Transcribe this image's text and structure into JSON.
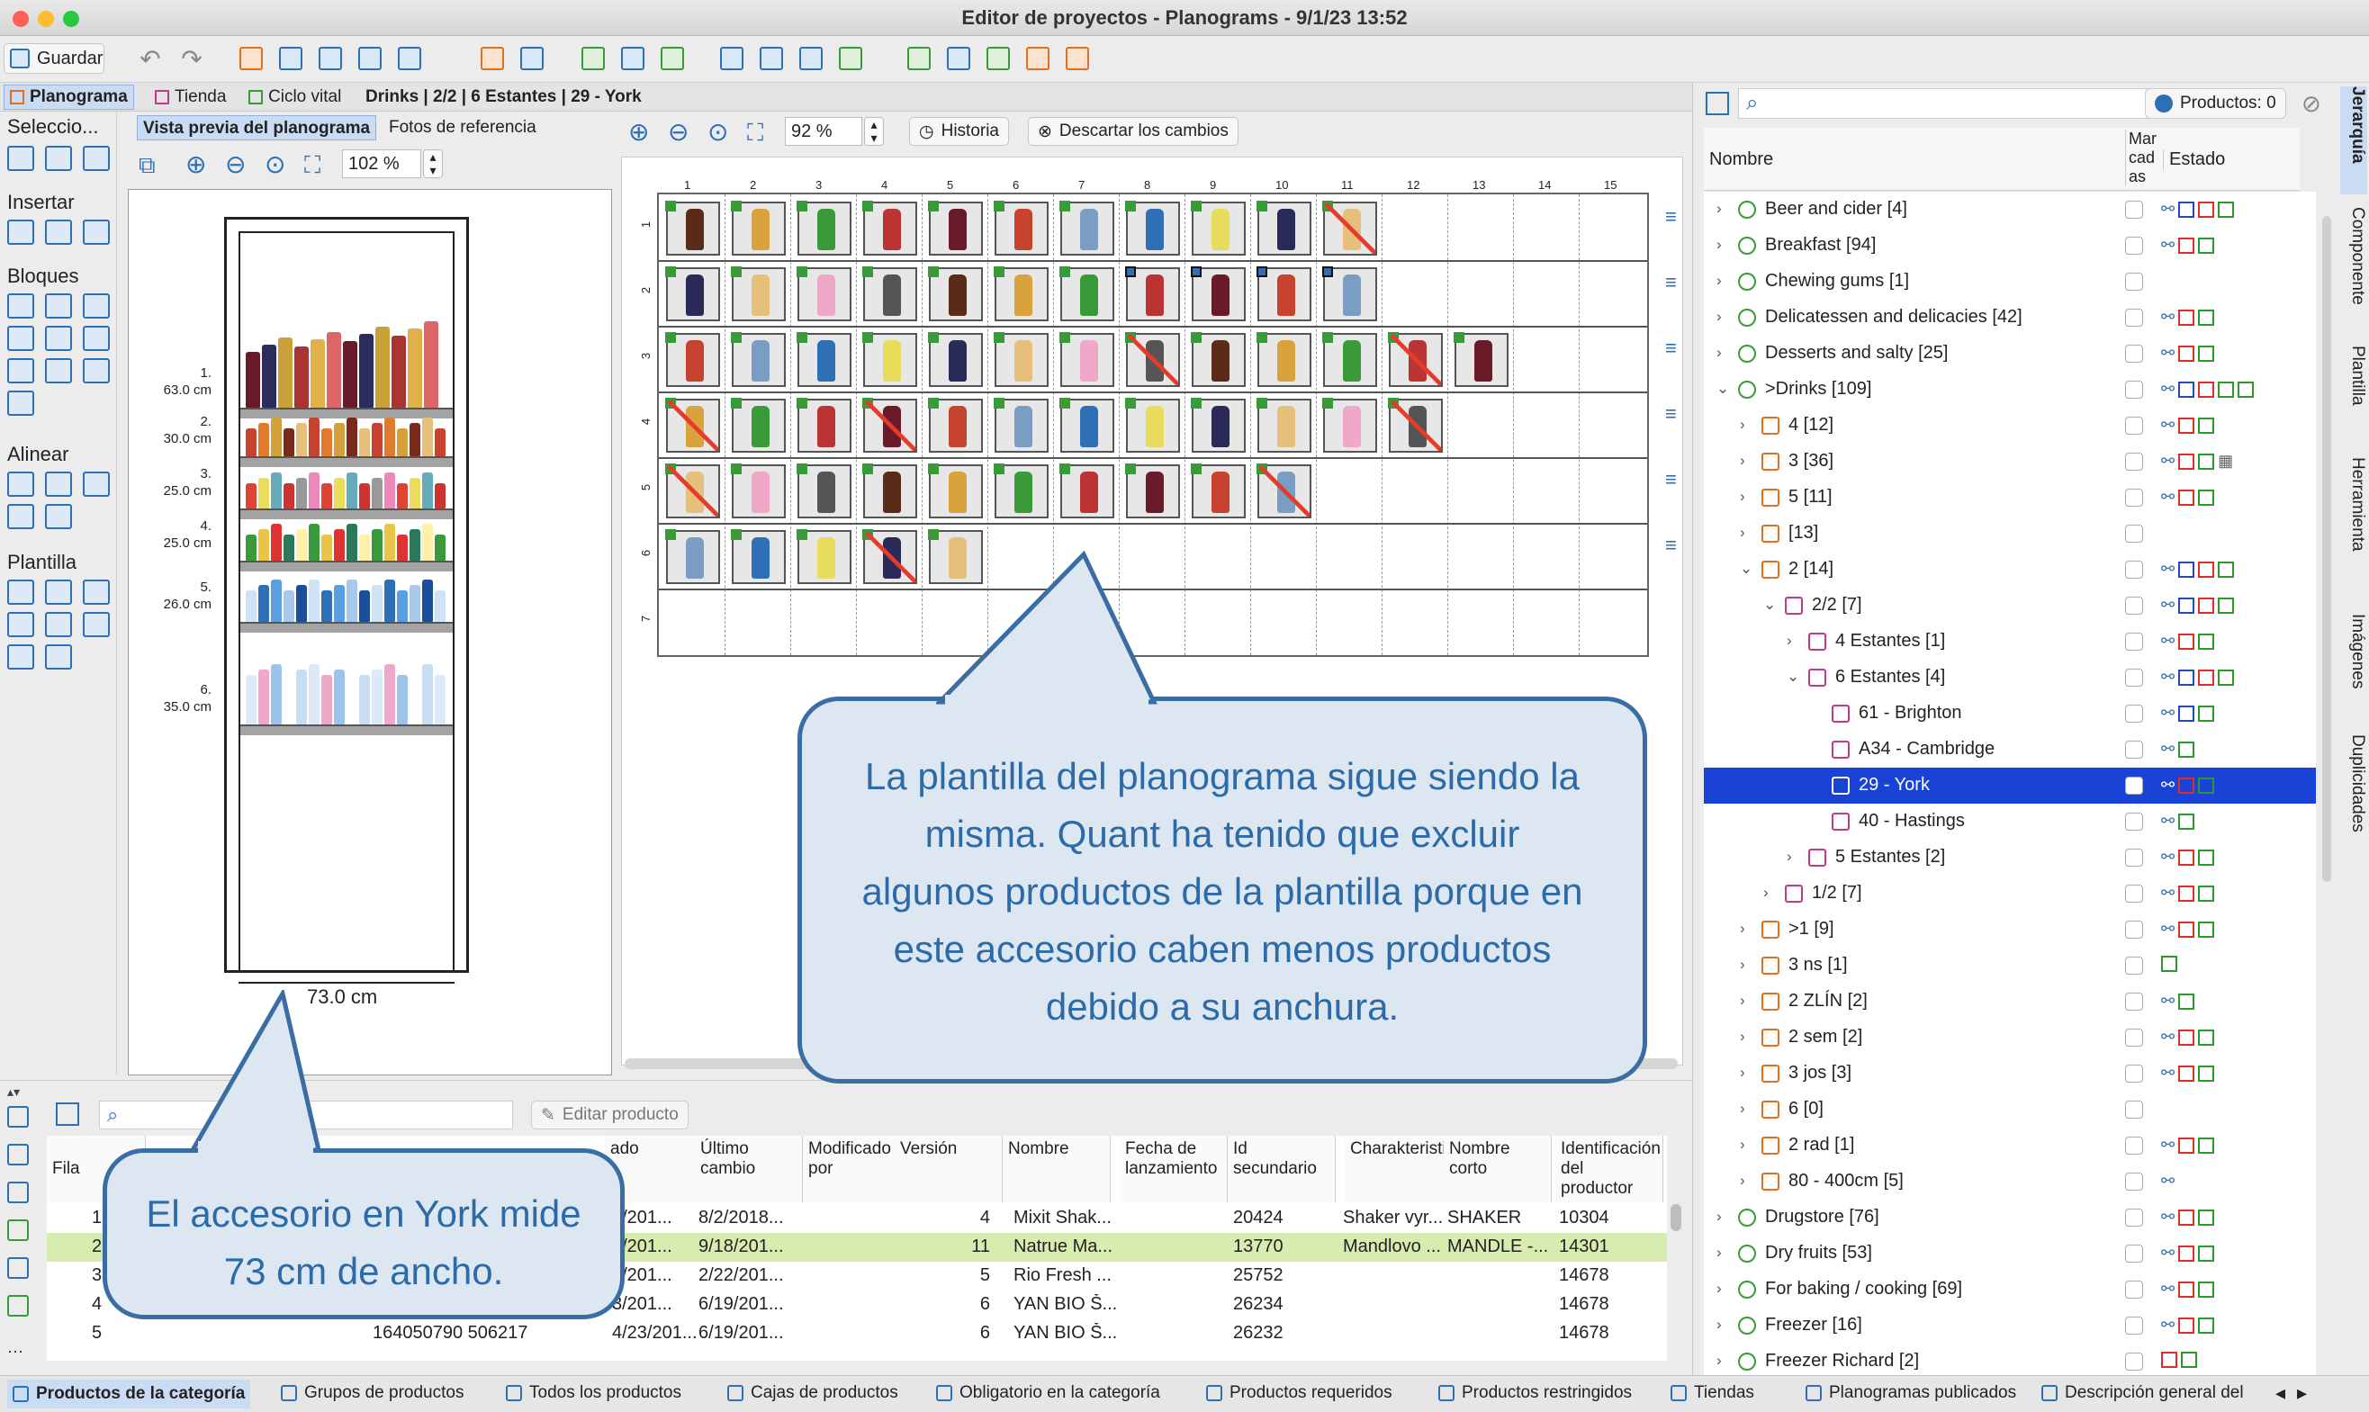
{
  "window": {
    "title": "Editor de proyectos - Planograms - 9/1/23 13:52"
  },
  "toolbar": {
    "save_label": "Guardar"
  },
  "tabs": {
    "planograma": "Planograma",
    "tienda": "Tienda",
    "ciclo": "Ciclo vital",
    "breadcrumb": "Drinks | 2/2 | 6 Estantes | 29 - York"
  },
  "left": {
    "selection": "Seleccio...",
    "insert": "Insertar",
    "blocks": "Bloques",
    "align": "Alinear",
    "template": "Plantilla"
  },
  "preview": {
    "tab_preview": "Vista previa del planograma",
    "tab_photos": "Fotos de referencia",
    "zoom": "102 %",
    "width_label": "73.0 cm",
    "shelves": [
      {
        "n": "1.",
        "h": "63.0 cm"
      },
      {
        "n": "2.",
        "h": "30.0 cm"
      },
      {
        "n": "3.",
        "h": "25.0 cm"
      },
      {
        "n": "4.",
        "h": "25.0 cm"
      },
      {
        "n": "5.",
        "h": "26.0 cm"
      },
      {
        "n": "6.",
        "h": "35.0 cm"
      }
    ]
  },
  "editor": {
    "zoom": "92 %",
    "history": "Historia",
    "discard": "Descartar los cambios",
    "cols": [
      "1",
      "2",
      "3",
      "4",
      "5",
      "6",
      "7",
      "8",
      "9",
      "10",
      "11",
      "12",
      "13",
      "14",
      "15"
    ],
    "rows": [
      "1",
      "2",
      "3",
      "4",
      "5",
      "6",
      "7"
    ]
  },
  "callouts": {
    "main": "La plantilla del planograma sigue siendo la misma. Quant ha tenido que excluir algunos productos de la plantilla porque en este accesorio caben menos productos debido a su anchura.",
    "small": "El accesorio en York mide 73 cm de ancho."
  },
  "products_panel": {
    "edit_button": "Editar producto",
    "headers": [
      "Fila",
      "ado",
      "Último cambio",
      "Modificado por",
      "Versión",
      "Nombre",
      "Fecha de lanzamiento",
      "Id secundario",
      "Charakteristika",
      "Nombre corto",
      "Identificación del productor"
    ],
    "rows": [
      {
        "fila": "1",
        "fecha": "4/201...",
        "ultimo": "8/2/2018...",
        "ver": "4",
        "nombre": "Mixit Shak...",
        "fl": "",
        "id2": "20424",
        "char": "Shaker vyr...",
        "corto": "SHAKER",
        "prod": "10304"
      },
      {
        "fila": "2",
        "fecha": "3/201...",
        "ultimo": "9/18/201...",
        "ver": "11",
        "nombre": "Natrue Ma...",
        "fl": "",
        "id2": "13770",
        "char": "Mandlovo ...",
        "corto": "MANDLE -...",
        "prod": "14301"
      },
      {
        "fila": "3",
        "fecha": "9/201...",
        "ultimo": "2/22/201...",
        "ver": "5",
        "nombre": "Rio Fresh ...",
        "fl": "",
        "id2": "25752",
        "char": "",
        "corto": "",
        "prod": "14678"
      },
      {
        "fila": "4",
        "fecha": "3/201...",
        "ultimo": "6/19/201...",
        "ver": "6",
        "nombre": "YAN BIO Š...",
        "fl": "",
        "id2": "26234",
        "char": "",
        "corto": "",
        "prod": "14678"
      },
      {
        "fila": "5",
        "fecha": "4/23/201...",
        "ultimo": "6/19/201...",
        "ver": "6",
        "nombre": "YAN BIO Š...",
        "fl": "",
        "id2": "26232",
        "char": "",
        "corto": "",
        "prod": "14678",
        "code": "164050790 506217"
      }
    ]
  },
  "tree": {
    "products_count": "Productos: 0",
    "col_name": "Nombre",
    "col_marked": "Mar cad as",
    "col_state": "Estado",
    "items": [
      {
        "label": "Beer and cider [4]",
        "st": "gbrg"
      },
      {
        "label": "Breakfast [94]",
        "st": "grg"
      },
      {
        "label": "Chewing gums [1]",
        "st": ""
      },
      {
        "label": "Delicatessen and delicacies [42]",
        "st": "grg"
      },
      {
        "label": "Desserts and salty [25]",
        "st": "grg"
      },
      {
        "label": ">Drinks [109]",
        "st": "bbrgg"
      },
      {
        "label": "4 [12]",
        "st": "brg"
      },
      {
        "label": "3 [36]",
        "st": "brgt"
      },
      {
        "label": "5 [11]",
        "st": "brg"
      },
      {
        "label": " [13]",
        "st": ""
      },
      {
        "label": "2 [14]",
        "st": "bbrg"
      },
      {
        "label": "2/2 [7]",
        "st": "bbrg"
      },
      {
        "label": "4 Estantes [1]",
        "st": "brg"
      },
      {
        "label": "6 Estantes [4]",
        "st": "bbrg"
      },
      {
        "label": "61 - Brighton",
        "st": "bbg"
      },
      {
        "label": "A34 - Cambridge",
        "st": "bg"
      },
      {
        "label": "29 - York",
        "st": "brg"
      },
      {
        "label": "40 - Hastings",
        "st": "bg"
      },
      {
        "label": "5 Estantes [2]",
        "st": "brg"
      },
      {
        "label": "1/2 [7]",
        "st": "brg"
      },
      {
        "label": ">1 [9]",
        "st": "brg"
      },
      {
        "label": "3 ns [1]",
        "st": "g"
      },
      {
        "label": "2 ZLÍN [2]",
        "st": "bg"
      },
      {
        "label": "2 sem [2]",
        "st": "brg"
      },
      {
        "label": "3 jos [3]",
        "st": "brg"
      },
      {
        "label": "6 [0]",
        "st": ""
      },
      {
        "label": "2 rad [1]",
        "st": "brg"
      },
      {
        "label": "80 - 400cm [5]",
        "st": "b"
      },
      {
        "label": "Drugstore [76]",
        "st": "brg"
      },
      {
        "label": "Dry fruits [53]",
        "st": "brg"
      },
      {
        "label": "For baking / cooking [69]",
        "st": "brg"
      },
      {
        "label": "Freezer [16]",
        "st": "brg"
      },
      {
        "label": "Freezer Richard [2]",
        "st": "rg"
      }
    ]
  },
  "side_tabs": [
    "Jerarquía",
    "Componente",
    "Plantilla",
    "Herramienta",
    "Imágenes",
    "Duplicidades"
  ],
  "status": [
    "Productos de la categoría",
    "Grupos de productos",
    "Todos los productos",
    "Cajas de productos",
    "Obligatorio en la categoría",
    "Productos requeridos",
    "Productos restringidos",
    "Tiendas",
    "Planogramas publicados",
    "Descripción general del"
  ]
}
